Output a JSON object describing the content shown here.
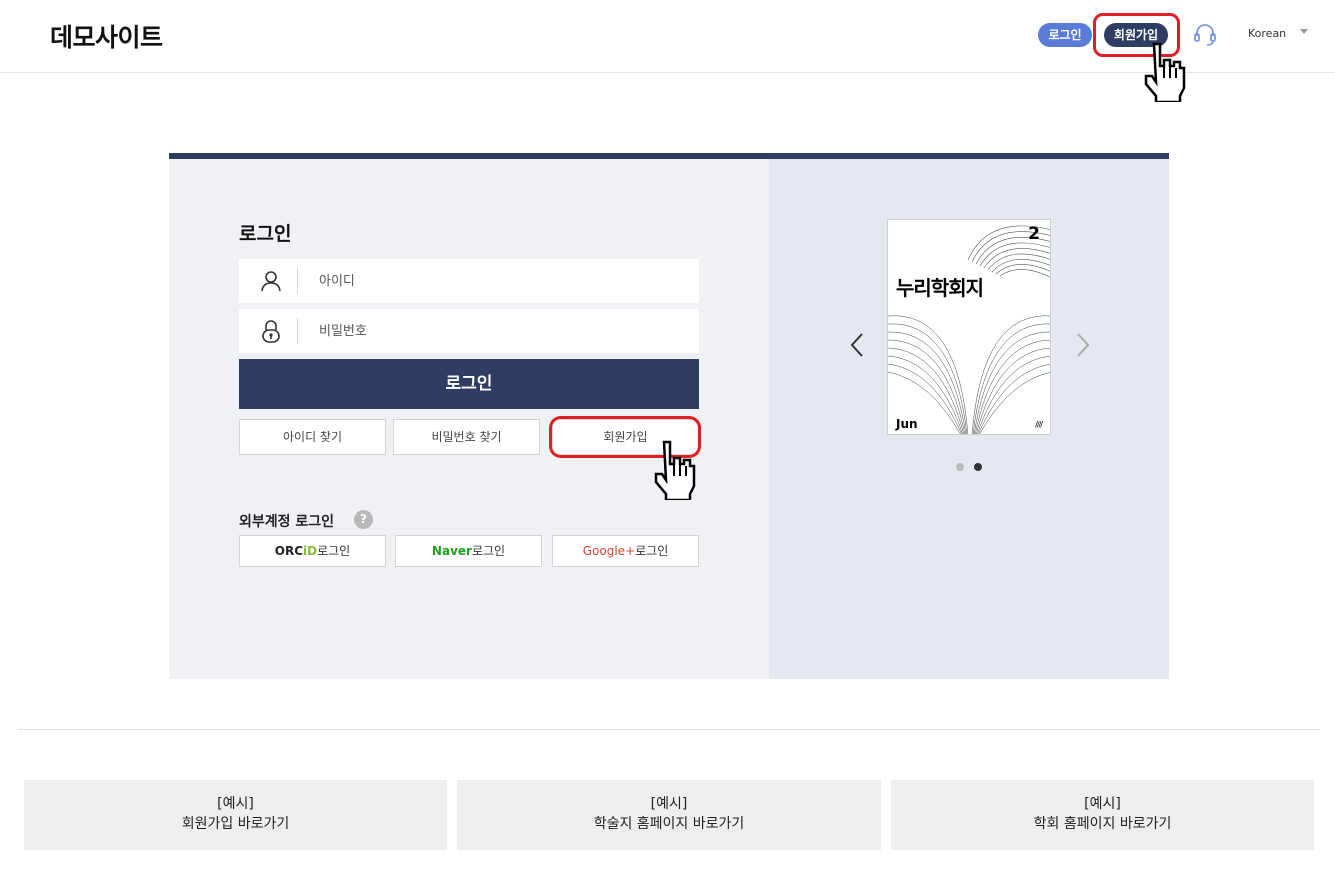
{
  "header": {
    "logo": "데모사이트",
    "login_label": "로그인",
    "join_label": "회원가입",
    "language": "Korean"
  },
  "login": {
    "title": "로그인",
    "id_placeholder": "아이디",
    "password_placeholder": "비밀번호",
    "submit_label": "로그인",
    "find_id_label": "아이디 찾기",
    "find_password_label": "비밀번호 찾기",
    "join_label": "회원가입",
    "external_title": "외부계정 로그인",
    "help_symbol": "?",
    "orcid_brand_a": "ORC",
    "orcid_brand_b": "iD",
    "orcid_suffix": "로그인",
    "naver_brand": "Naver",
    "naver_suffix": "로그인",
    "google_brand": "Google+",
    "google_suffix": "로그인"
  },
  "carousel": {
    "cover_number": "2",
    "cover_title": "누리학회지",
    "cover_month": "Jun",
    "cover_mark": "////",
    "active_slide": 2,
    "slide_count": 2
  },
  "shortcuts": [
    {
      "line1": "[예시]",
      "line2": "회원가입 바로가기"
    },
    {
      "line1": "[예시]",
      "line2": "학술지 홈페이지 바로가기"
    },
    {
      "line1": "[예시]",
      "line2": "학회 홈페이지 바로가기"
    }
  ],
  "colors": {
    "navy": "#2f3d63",
    "login_pill": "#5a7bd8",
    "highlight": "#e11d25",
    "naver_green": "#1ea21e",
    "google_red": "#d34836",
    "orcid_green": "#8ab93b"
  },
  "icons": [
    "user-icon",
    "lock-icon",
    "headset-icon",
    "chevron-left-icon",
    "chevron-right-icon",
    "pointer-cursor-icon"
  ]
}
